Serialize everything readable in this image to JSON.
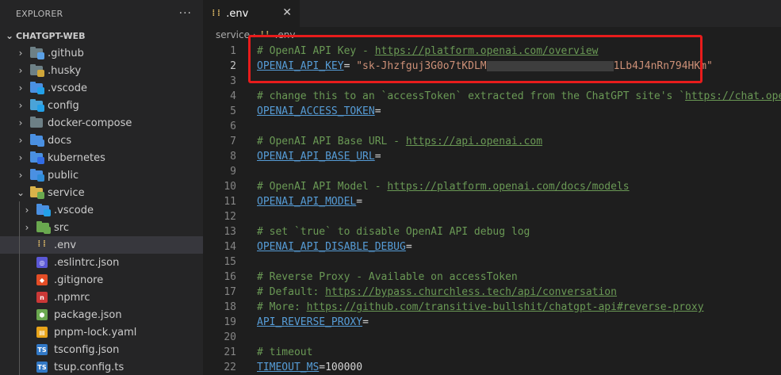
{
  "sidebar": {
    "title": "EXPLORER",
    "more_icon": "ellipsis-icon",
    "root": "CHATGPT-WEB",
    "items": [
      {
        "label": ".github",
        "type": "folder",
        "color": "#6d8086",
        "badge": "●",
        "badge_color": "#5aa0e6",
        "depth": 0
      },
      {
        "label": ".husky",
        "type": "folder",
        "color": "#6d8086",
        "badge": "🐶",
        "badge_color": "#cfa63a",
        "depth": 0
      },
      {
        "label": ".vscode",
        "type": "folder",
        "color": "#4a90e2",
        "badge": "<",
        "badge_color": "#23a0e8",
        "depth": 0
      },
      {
        "label": "config",
        "type": "folder",
        "color": "#4aa3d8",
        "badge": "⚙",
        "badge_color": "#23a0e8",
        "depth": 0
      },
      {
        "label": "docker-compose",
        "type": "folder",
        "color": "#6d8086",
        "badge": "",
        "badge_color": "",
        "depth": 0
      },
      {
        "label": "docs",
        "type": "folder",
        "color": "#4a90e2",
        "badge": "",
        "badge_color": "#4a90e2",
        "depth": 0
      },
      {
        "label": "kubernetes",
        "type": "folder",
        "color": "#4a90e2",
        "badge": "⎈",
        "badge_color": "#326ce5",
        "depth": 0
      },
      {
        "label": "public",
        "type": "folder",
        "color": "#4a90e2",
        "badge": "◉",
        "badge_color": "#2f8cd8",
        "depth": 0
      },
      {
        "label": "service",
        "type": "folder-open",
        "color": "#d9b24a",
        "badge": "",
        "badge_color": "#6aa84f",
        "depth": 0
      },
      {
        "label": ".vscode",
        "type": "folder",
        "color": "#4a90e2",
        "badge": "<",
        "badge_color": "#23a0e8",
        "depth": 1
      },
      {
        "label": "src",
        "type": "folder",
        "color": "#6aa84f",
        "badge": "",
        "badge_color": "#6aa84f",
        "depth": 1
      },
      {
        "label": ".env",
        "type": "env",
        "color": "#e8c26a",
        "badge": "",
        "badge_color": "",
        "depth": 1
      },
      {
        "label": ".eslintrc.json",
        "type": "file",
        "color": "#5b58d6",
        "badge": "◎",
        "badge_color": "",
        "depth": 1
      },
      {
        "label": ".gitignore",
        "type": "file",
        "color": "#e44d26",
        "badge": "◆",
        "badge_color": "",
        "depth": 1
      },
      {
        "label": ".npmrc",
        "type": "file",
        "color": "#cb3837",
        "badge": "n",
        "badge_color": "",
        "depth": 1
      },
      {
        "label": "package.json",
        "type": "file",
        "color": "#6aa84f",
        "badge": "⬢",
        "badge_color": "",
        "depth": 1
      },
      {
        "label": "pnpm-lock.yaml",
        "type": "file",
        "color": "#e8a41a",
        "badge": "▤",
        "badge_color": "",
        "depth": 1
      },
      {
        "label": "tsconfig.json",
        "type": "file",
        "color": "#3178c6",
        "badge": "TS",
        "badge_color": "",
        "depth": 1
      },
      {
        "label": "tsup.config.ts",
        "type": "file",
        "color": "#3178c6",
        "badge": "TS",
        "badge_color": "",
        "depth": 1
      }
    ]
  },
  "tab": {
    "icon": "env-file-icon",
    "icon_text": "⁞⁞",
    "label": ".env",
    "close_glyph": "✕"
  },
  "breadcrumb": {
    "parts": [
      "service",
      ".env"
    ],
    "separator": "›"
  },
  "editor": {
    "highlight_color": "#e81c1c",
    "lines": [
      {
        "n": "1",
        "tokens": [
          {
            "t": "# OpenAI API Key - ",
            "c": "cm"
          },
          {
            "t": "https://platform.openai.com/overview",
            "c": "lk"
          }
        ]
      },
      {
        "n": "2",
        "tokens": [
          {
            "t": "OPENAI_API_KEY",
            "c": "key"
          },
          {
            "t": "= ",
            "c": "eq"
          },
          {
            "t": "\"sk-Jhzfguj3G0o7tKDLM",
            "c": "str"
          },
          {
            "redact": true
          },
          {
            "t": "1Lb4J4nRn794HKm\"",
            "c": "str"
          }
        ]
      },
      {
        "n": "3",
        "tokens": []
      },
      {
        "n": "4",
        "tokens": [
          {
            "t": "# change this to an `accessToken` extracted from the ChatGPT site's `",
            "c": "cm"
          },
          {
            "t": "https://chat.open",
            "c": "lk"
          }
        ]
      },
      {
        "n": "5",
        "tokens": [
          {
            "t": "OPENAI_ACCESS_TOKEN",
            "c": "key"
          },
          {
            "t": "=",
            "c": "eq"
          }
        ]
      },
      {
        "n": "6",
        "tokens": []
      },
      {
        "n": "7",
        "tokens": [
          {
            "t": "# OpenAI API Base URL - ",
            "c": "cm"
          },
          {
            "t": "https://api.openai.com",
            "c": "lk"
          }
        ]
      },
      {
        "n": "8",
        "tokens": [
          {
            "t": "OPENAI_API_BASE_URL",
            "c": "key"
          },
          {
            "t": "=",
            "c": "eq"
          }
        ]
      },
      {
        "n": "9",
        "tokens": []
      },
      {
        "n": "10",
        "tokens": [
          {
            "t": "# OpenAI API Model - ",
            "c": "cm"
          },
          {
            "t": "https://platform.openai.com/docs/models",
            "c": "lk"
          }
        ]
      },
      {
        "n": "11",
        "tokens": [
          {
            "t": "OPENAI_API_MODEL",
            "c": "key"
          },
          {
            "t": "=",
            "c": "eq"
          }
        ]
      },
      {
        "n": "12",
        "tokens": []
      },
      {
        "n": "13",
        "tokens": [
          {
            "t": "# set `true` to disable OpenAI API debug log",
            "c": "cm"
          }
        ]
      },
      {
        "n": "14",
        "tokens": [
          {
            "t": "OPENAI_API_DISABLE_DEBUG",
            "c": "key"
          },
          {
            "t": "=",
            "c": "eq"
          }
        ]
      },
      {
        "n": "15",
        "tokens": []
      },
      {
        "n": "16",
        "tokens": [
          {
            "t": "# Reverse Proxy - Available on accessToken",
            "c": "cm"
          }
        ]
      },
      {
        "n": "17",
        "tokens": [
          {
            "t": "# Default: ",
            "c": "cm"
          },
          {
            "t": "https://bypass.churchless.tech/api/conversation",
            "c": "lk"
          }
        ]
      },
      {
        "n": "18",
        "tokens": [
          {
            "t": "# More: ",
            "c": "cm"
          },
          {
            "t": "https://github.com/transitive-bullshit/chatgpt-api#reverse-proxy",
            "c": "lk"
          }
        ]
      },
      {
        "n": "19",
        "tokens": [
          {
            "t": "API_REVERSE_PROXY",
            "c": "key"
          },
          {
            "t": "=",
            "c": "eq"
          }
        ]
      },
      {
        "n": "20",
        "tokens": []
      },
      {
        "n": "21",
        "tokens": [
          {
            "t": "# timeout",
            "c": "cm"
          }
        ]
      },
      {
        "n": "22",
        "tokens": [
          {
            "t": "TIMEOUT_MS",
            "c": "key"
          },
          {
            "t": "=",
            "c": "eq"
          },
          {
            "t": "100000",
            "c": "num"
          }
        ]
      }
    ]
  }
}
